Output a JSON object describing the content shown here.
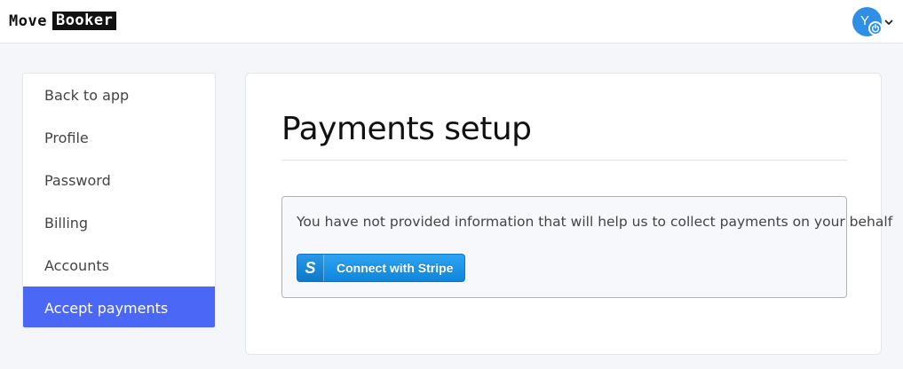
{
  "header": {
    "logo_move": "Move",
    "logo_booker": "Booker",
    "avatar_letter": "Y"
  },
  "sidebar": {
    "items": [
      {
        "label": "Back to app"
      },
      {
        "label": "Profile"
      },
      {
        "label": "Password"
      },
      {
        "label": "Billing"
      },
      {
        "label": "Accounts"
      },
      {
        "label": "Accept payments",
        "active": true
      }
    ]
  },
  "main": {
    "title": "Payments setup",
    "notice_text": "You have not provided information that will help us to collect payments on your behalf",
    "stripe_button": {
      "icon_letter": "S",
      "label": "Connect with Stripe"
    }
  },
  "colors": {
    "accent": "#4a68f5",
    "avatar": "#2f8fe6",
    "stripe": "#0f86dc"
  }
}
